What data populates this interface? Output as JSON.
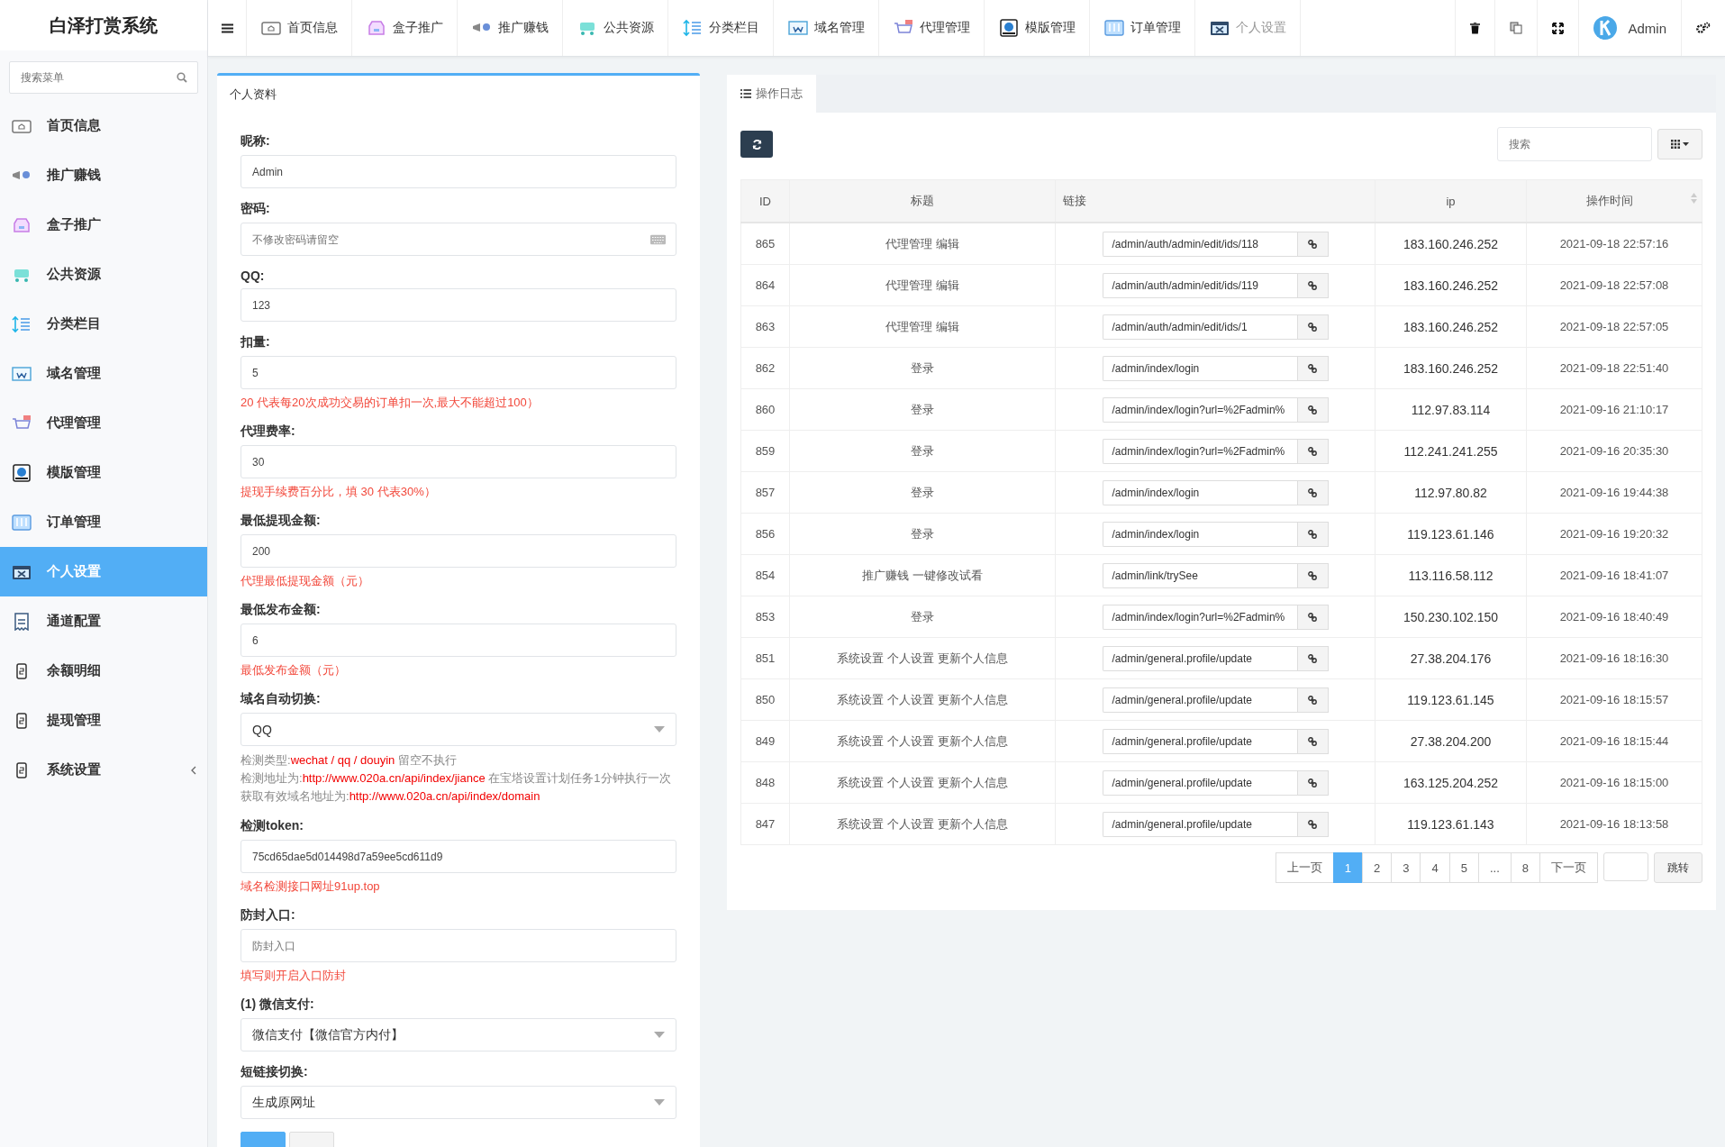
{
  "logo": "白泽打赏系统",
  "sidebar": {
    "search": {
      "placeholder": "搜索菜单"
    },
    "items": [
      {
        "label": "首页信息",
        "selected": false,
        "expandable": false
      },
      {
        "label": "推广赚钱",
        "selected": false,
        "expandable": false
      },
      {
        "label": "盒子推广",
        "selected": false,
        "expandable": false
      },
      {
        "label": "公共资源",
        "selected": false,
        "expandable": false
      },
      {
        "label": "分类栏目",
        "selected": false,
        "expandable": false
      },
      {
        "label": "域名管理",
        "selected": false,
        "expandable": false
      },
      {
        "label": "代理管理",
        "selected": false,
        "expandable": false
      },
      {
        "label": "模版管理",
        "selected": false,
        "expandable": false
      },
      {
        "label": "订单管理",
        "selected": false,
        "expandable": false
      },
      {
        "label": "个人设置",
        "selected": true,
        "expandable": false
      },
      {
        "label": "通道配置",
        "selected": false,
        "expandable": false
      },
      {
        "label": "余额明细",
        "selected": false,
        "expandable": false
      },
      {
        "label": "提现管理",
        "selected": false,
        "expandable": false
      },
      {
        "label": "系统设置",
        "selected": false,
        "expandable": true
      }
    ]
  },
  "top_nav": [
    {
      "label": "首页信息",
      "selected": false
    },
    {
      "label": "盒子推广",
      "selected": false
    },
    {
      "label": "推广赚钱",
      "selected": false
    },
    {
      "label": "公共资源",
      "selected": false
    },
    {
      "label": "分类栏目",
      "selected": false
    },
    {
      "label": "域名管理",
      "selected": false
    },
    {
      "label": "代理管理",
      "selected": false
    },
    {
      "label": "模版管理",
      "selected": false
    },
    {
      "label": "订单管理",
      "selected": false
    },
    {
      "label": "个人设置",
      "selected": true
    }
  ],
  "user": {
    "name": "Admin"
  },
  "profile": {
    "title": "个人资料",
    "fields": [
      {
        "label": "昵称:",
        "kind": "text",
        "value": "Admin"
      },
      {
        "label": "密码:",
        "kind": "password",
        "placeholder": "不修改密码请留空"
      },
      {
        "label": "QQ:",
        "kind": "text",
        "value": "123"
      },
      {
        "label": "扣量:",
        "kind": "text",
        "value": "5",
        "help": "20 代表每20次成功交易的订单扣一次,最大不能超过100）"
      },
      {
        "label": "代理费率:",
        "kind": "text",
        "value": "30",
        "help": "提现手续费百分比，填 30 代表30%）"
      },
      {
        "label": "最低提现金额:",
        "kind": "text",
        "value": "200",
        "help": "代理最低提现金额（元）"
      },
      {
        "label": "最低发布金额:",
        "kind": "text",
        "value": "6",
        "help": "最低发布金额（元）"
      },
      {
        "label": "域名自动切换:",
        "kind": "select",
        "value": "QQ",
        "notes": [
          [
            {
              "text": "检测类型:",
              "highlight": false
            },
            {
              "text": "wechat / qq / douyin",
              "highlight": true
            },
            {
              "text": " 留空不执行",
              "highlight": false
            }
          ],
          [
            {
              "text": "检测地址为:",
              "highlight": false
            },
            {
              "text": "http://www.020a.cn/api/index/jiance",
              "highlight": true
            },
            {
              "text": " 在宝塔设置计划任务1分钟执行一次",
              "highlight": false
            }
          ],
          [
            {
              "text": "获取有效域名地址为:",
              "highlight": false
            },
            {
              "text": "http://www.020a.cn/api/index/domain",
              "highlight": true
            }
          ]
        ]
      },
      {
        "label": "检测token:",
        "kind": "text",
        "value": "75cd65dae5d014498d7a59ee5cd611d9",
        "help": "域名检测接口网址91up.top"
      },
      {
        "label": "防封入口:",
        "kind": "text",
        "placeholder": "防封入口",
        "help": "填写则开启入口防封"
      },
      {
        "label": "(1) 微信支付:",
        "kind": "select",
        "value": "微信支付【微信官方内付】"
      },
      {
        "label": "短链接切换:",
        "kind": "select",
        "value": "生成原网址"
      }
    ],
    "buttons": [
      {
        "kind": "primary"
      },
      {
        "kind": "default"
      }
    ]
  },
  "log": {
    "tab": "操作日志",
    "search": {
      "placeholder": "搜索"
    },
    "table": {
      "columns": [
        "ID",
        "标题",
        "链接",
        "ip",
        "操作时间"
      ],
      "rows": [
        {
          "id": "865",
          "title": "代理管理 编辑",
          "link": "/admin/auth/admin/edit/ids/118",
          "ip": "183.160.246.252",
          "time": "2021-09-18 22:57:16"
        },
        {
          "id": "864",
          "title": "代理管理 编辑",
          "link": "/admin/auth/admin/edit/ids/119",
          "ip": "183.160.246.252",
          "time": "2021-09-18 22:57:08"
        },
        {
          "id": "863",
          "title": "代理管理 编辑",
          "link": "/admin/auth/admin/edit/ids/1",
          "ip": "183.160.246.252",
          "time": "2021-09-18 22:57:05"
        },
        {
          "id": "862",
          "title": "登录",
          "link": "/admin/index/login",
          "ip": "183.160.246.252",
          "time": "2021-09-18 22:51:40"
        },
        {
          "id": "860",
          "title": "登录",
          "link": "/admin/index/login?url=%2Fadmin%",
          "ip": "112.97.83.114",
          "time": "2021-09-16 21:10:17"
        },
        {
          "id": "859",
          "title": "登录",
          "link": "/admin/index/login?url=%2Fadmin%",
          "ip": "112.241.241.255",
          "time": "2021-09-16 20:35:30"
        },
        {
          "id": "857",
          "title": "登录",
          "link": "/admin/index/login",
          "ip": "112.97.80.82",
          "time": "2021-09-16 19:44:38"
        },
        {
          "id": "856",
          "title": "登录",
          "link": "/admin/index/login",
          "ip": "119.123.61.146",
          "time": "2021-09-16 19:20:32"
        },
        {
          "id": "854",
          "title": "推广赚钱 一键修改试看",
          "link": "/admin/link/trySee",
          "ip": "113.116.58.112",
          "time": "2021-09-16 18:41:07"
        },
        {
          "id": "853",
          "title": "登录",
          "link": "/admin/index/login?url=%2Fadmin%",
          "ip": "150.230.102.150",
          "time": "2021-09-16 18:40:49"
        },
        {
          "id": "851",
          "title": "系统设置 个人设置 更新个人信息",
          "link": "/admin/general.profile/update",
          "ip": "27.38.204.176",
          "time": "2021-09-16 18:16:30"
        },
        {
          "id": "850",
          "title": "系统设置 个人设置 更新个人信息",
          "link": "/admin/general.profile/update",
          "ip": "119.123.61.145",
          "time": "2021-09-16 18:15:57"
        },
        {
          "id": "849",
          "title": "系统设置 个人设置 更新个人信息",
          "link": "/admin/general.profile/update",
          "ip": "27.38.204.200",
          "time": "2021-09-16 18:15:44"
        },
        {
          "id": "848",
          "title": "系统设置 个人设置 更新个人信息",
          "link": "/admin/general.profile/update",
          "ip": "163.125.204.252",
          "time": "2021-09-16 18:15:00"
        },
        {
          "id": "847",
          "title": "系统设置 个人设置 更新个人信息",
          "link": "/admin/general.profile/update",
          "ip": "119.123.61.143",
          "time": "2021-09-16 18:13:58"
        }
      ]
    },
    "pagination": {
      "prev": "上一页",
      "pages": [
        {
          "label": "1",
          "selected": true
        },
        {
          "label": "2",
          "selected": false
        },
        {
          "label": "3",
          "selected": false
        },
        {
          "label": "4",
          "selected": false
        },
        {
          "label": "5",
          "selected": false
        },
        {
          "label": "...",
          "selected": false
        },
        {
          "label": "8",
          "selected": false
        }
      ],
      "next": "下一页",
      "jump": "跳转"
    }
  }
}
